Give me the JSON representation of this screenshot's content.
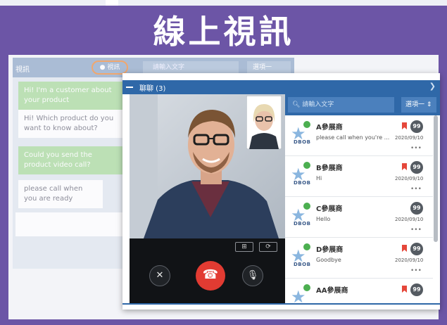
{
  "banner": {
    "title": "線上視訊"
  },
  "back_window": {
    "header_label": "視訊",
    "pill_label": "● 視訊",
    "search_placeholder": "請輸入文字",
    "select_label": "選項一",
    "messages": [
      {
        "text": "Hi! I'm a customer about your product",
        "time": ""
      },
      {
        "text": "Hi! Which product do you want to know about?",
        "time": ""
      },
      {
        "text": "Could you send the product video call?",
        "time": ""
      },
      {
        "text": "please call when you are ready",
        "time": ""
      }
    ]
  },
  "chat_window": {
    "title": "聊聊 (3)",
    "search_placeholder": "請輸入文字",
    "select_label": "選項一",
    "controls": {
      "camera_off": "camera-off",
      "end_call": "end-call",
      "mute": "mute"
    },
    "contacts": [
      {
        "logo": "DBOB",
        "name": "A參展商",
        "message": "please call when you're ...",
        "badge": "99",
        "date": "2020/09/10",
        "flag": true
      },
      {
        "logo": "DBOB",
        "name": "B參展商",
        "message": "Hi",
        "badge": "99",
        "date": "2020/09/10",
        "flag": true
      },
      {
        "logo": "DBOB",
        "name": "C參展商",
        "message": "Hello",
        "badge": "99",
        "date": "2020/09/10",
        "flag": false
      },
      {
        "logo": "DBOB",
        "name": "D參展商",
        "message": "Goodbye",
        "badge": "99",
        "date": "2020/09/10",
        "flag": true
      },
      {
        "logo": "DBOB",
        "name": "AA參展商",
        "message": "",
        "badge": "99",
        "date": "",
        "flag": true
      }
    ]
  },
  "colors": {
    "banner": "#6c55a6",
    "window_header": "#2f68a8",
    "end_call": "#e23b32",
    "online": "#4caf50",
    "flag": "#e5473a"
  }
}
